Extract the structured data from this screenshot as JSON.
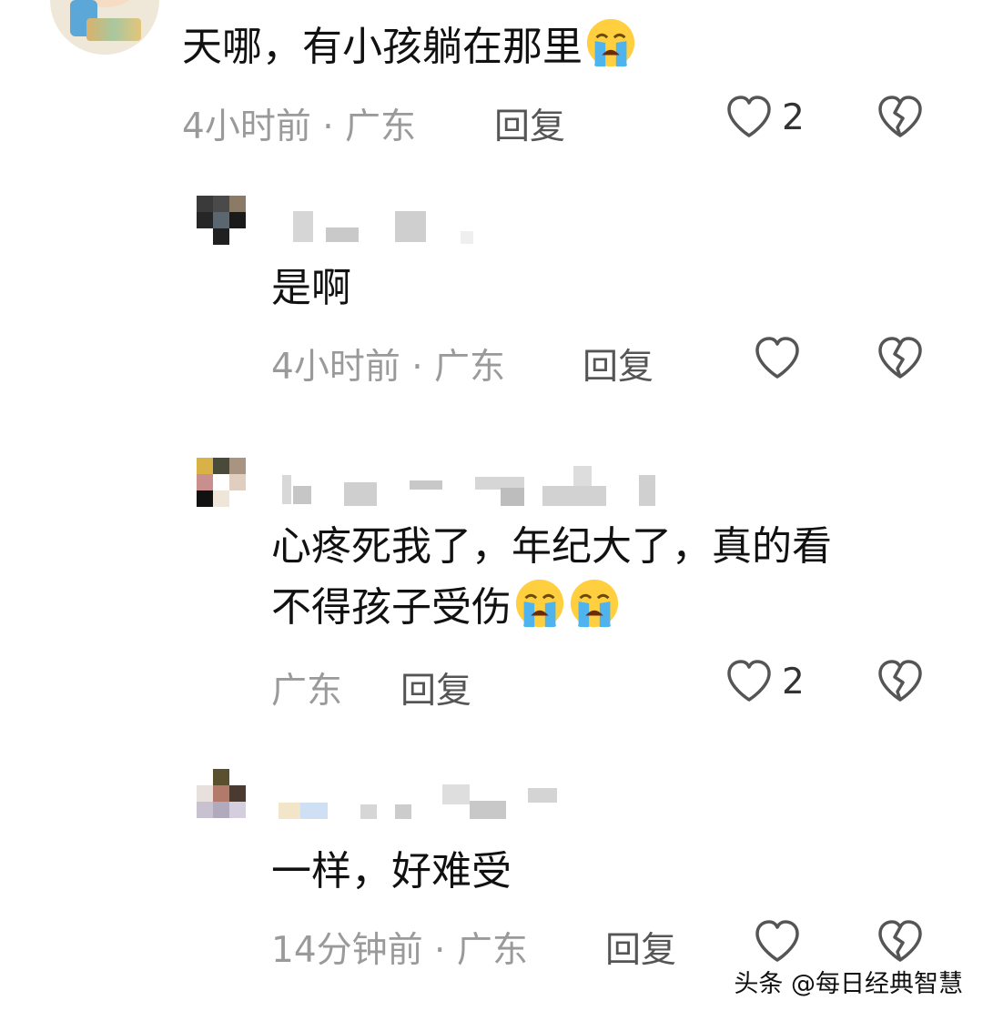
{
  "comments": [
    {
      "text": "天哪，有小孩躺在那里",
      "meta": "4小时前 · 广东",
      "reply_label": "回复",
      "like_count": "2",
      "emojis": [
        "loudly-crying-face"
      ]
    },
    {
      "text": "是啊",
      "meta": "4小时前 · 广东",
      "reply_label": "回复",
      "like_count": ""
    },
    {
      "text_line1": "心疼死我了，年纪大了，真的看",
      "text_line2": "不得孩子受伤",
      "meta": "广东",
      "reply_label": "回复",
      "like_count": "2",
      "emojis": [
        "loudly-crying-face",
        "loudly-crying-face"
      ]
    },
    {
      "text": "一样，好难受",
      "meta": "14分钟前 · 广东",
      "reply_label": "回复",
      "like_count": ""
    }
  ],
  "watermark": "头条 @每日经典智慧",
  "colors": {
    "meta_gray": "#9a9a9a",
    "icon_gray": "#555555"
  }
}
